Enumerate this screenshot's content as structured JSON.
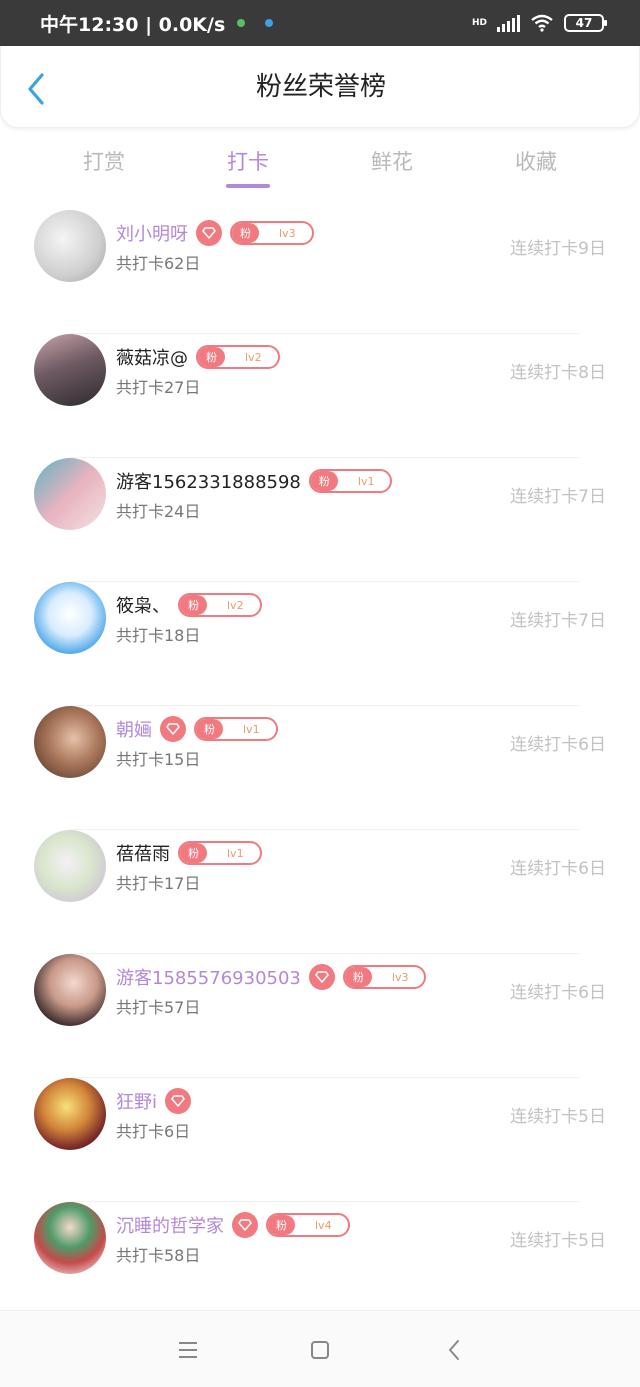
{
  "status": {
    "time_text": "中午12:30 | 0.0K/s",
    "network": "HD",
    "battery": "47"
  },
  "header": {
    "title": "粉丝荣誉榜"
  },
  "tabs": [
    {
      "label": "打赏",
      "active": false
    },
    {
      "label": "打卡",
      "active": true
    },
    {
      "label": "鲜花",
      "active": false
    },
    {
      "label": "收藏",
      "active": false
    }
  ],
  "fans": [
    {
      "name": "刘小明呀",
      "vip": true,
      "badge_text": "粉",
      "level": "lv3",
      "total": "共打卡62日",
      "streak": "连续打卡9日"
    },
    {
      "name": "薇菇凉@",
      "vip": false,
      "badge_text": "粉",
      "level": "lv2",
      "total": "共打卡27日",
      "streak": "连续打卡8日"
    },
    {
      "name": "游客1562331888598",
      "vip": false,
      "badge_text": "粉",
      "level": "lv1",
      "total": "共打卡24日",
      "streak": "连续打卡7日"
    },
    {
      "name": "筱枭、",
      "vip": false,
      "badge_text": "粉",
      "level": "lv2",
      "total": "共打卡18日",
      "streak": "连续打卡7日"
    },
    {
      "name": "朝婳",
      "vip": true,
      "badge_text": "粉",
      "level": "lv1",
      "total": "共打卡15日",
      "streak": "连续打卡6日"
    },
    {
      "name": "蓓蓓雨",
      "vip": false,
      "badge_text": "粉",
      "level": "lv1",
      "total": "共打卡17日",
      "streak": "连续打卡6日"
    },
    {
      "name": "游客1585576930503",
      "vip": true,
      "badge_text": "粉",
      "level": "lv3",
      "total": "共打卡57日",
      "streak": "连续打卡6日"
    },
    {
      "name": "狂野i",
      "vip": true,
      "badge_text": "",
      "level": "",
      "total": "共打卡6日",
      "streak": "连续打卡5日"
    },
    {
      "name": "沉睡的哲学家",
      "vip": true,
      "badge_text": "粉",
      "level": "lv4",
      "total": "共打卡58日",
      "streak": "连续打卡5日"
    }
  ],
  "colors": {
    "accent": "#b388d9",
    "badge": "#f07a80",
    "streak": "#c2c2c2",
    "back": "#3aa3e0"
  },
  "icons": {
    "back": "chevron-left-icon",
    "gem": "diamond-icon",
    "nav_menu": "menu-icon",
    "nav_home": "square-icon",
    "nav_back": "chevron-left-icon"
  }
}
